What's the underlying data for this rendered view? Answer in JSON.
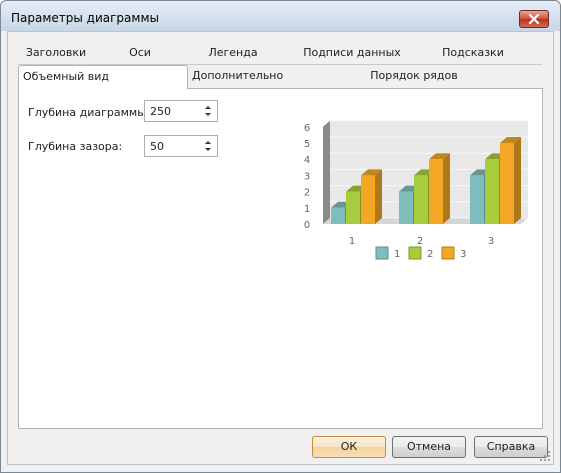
{
  "window": {
    "title": "Параметры диаграммы"
  },
  "tabs_row1": [
    "Заголовки",
    "Оси",
    "Легенда",
    "Подписи данных",
    "Подсказки"
  ],
  "tabs_row2": [
    "Объемный вид",
    "Дополнительно",
    "Порядок рядов"
  ],
  "active_tab": "Объемный вид",
  "fields": {
    "depth_label": "Глубина диаграммы:",
    "depth_value": "250",
    "gap_label": "Глубина зазора:",
    "gap_value": "50"
  },
  "buttons": {
    "ok": "ОК",
    "cancel": "Отмена",
    "help": "Справка"
  },
  "chart_data": {
    "type": "bar",
    "categories": [
      "1",
      "2",
      "3"
    ],
    "series": [
      {
        "name": "1",
        "values": [
          1,
          2,
          3
        ],
        "color": "#7fbdbc"
      },
      {
        "name": "2",
        "values": [
          2,
          3,
          4
        ],
        "color": "#a8cc3c"
      },
      {
        "name": "3",
        "values": [
          3,
          4,
          5
        ],
        "color": "#f3a724"
      }
    ],
    "y_ticks": [
      "0",
      "1",
      "2",
      "3",
      "4",
      "5",
      "6"
    ],
    "ylim": [
      0,
      6
    ],
    "style": "3d",
    "legend_position": "bottom"
  }
}
